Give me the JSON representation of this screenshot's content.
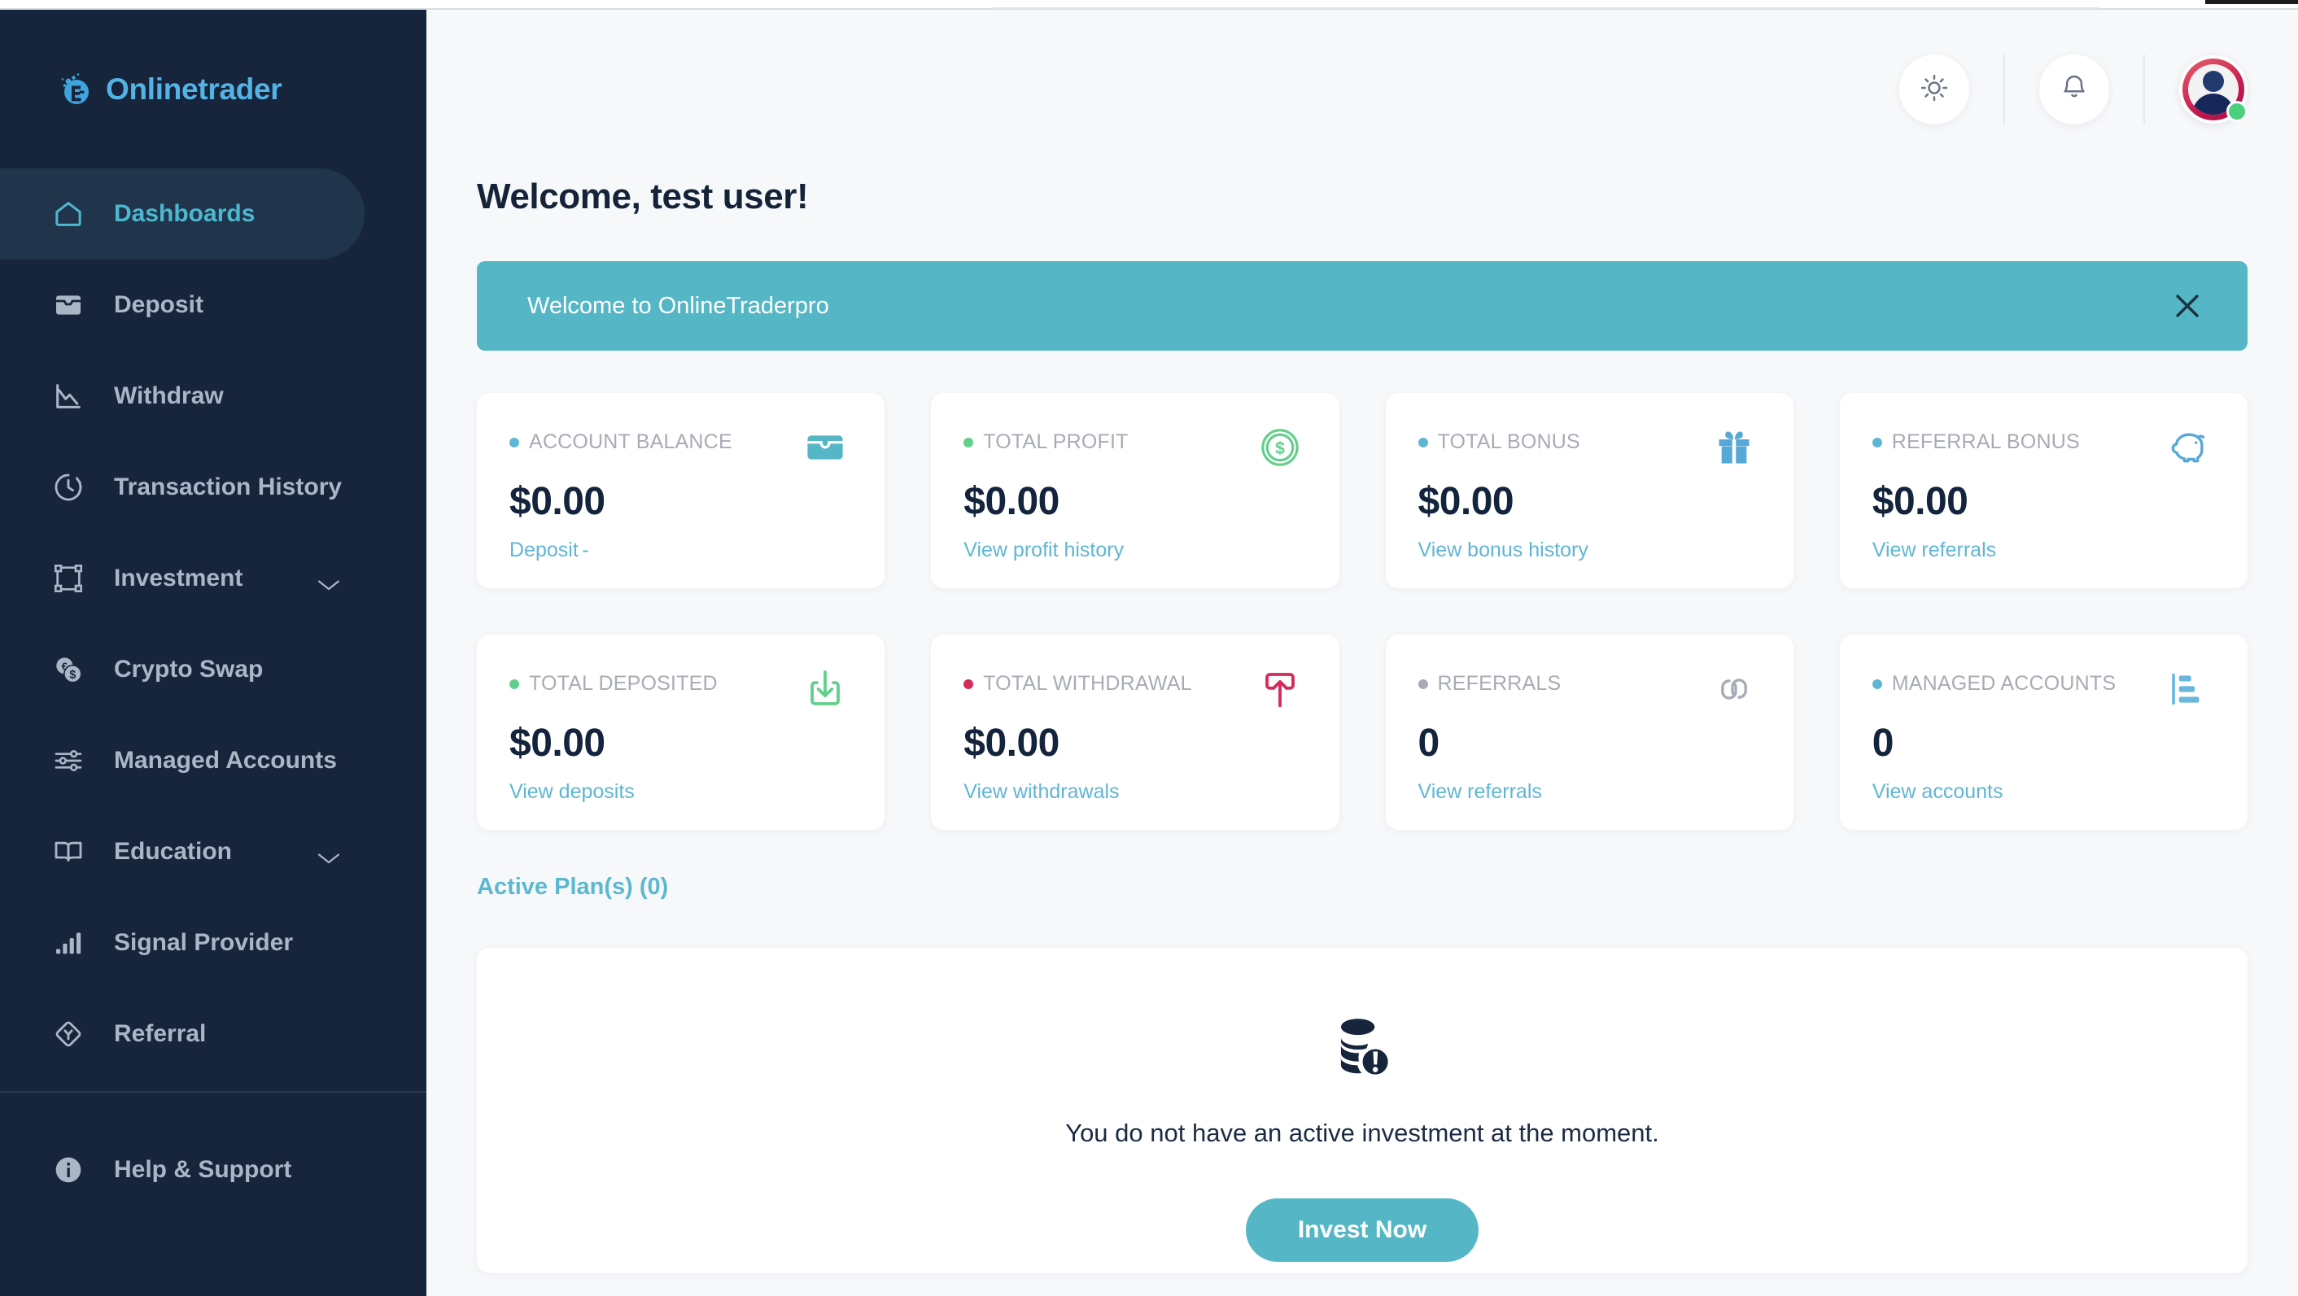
{
  "brand": {
    "name": "Onlinetrader",
    "logo_icon": "onlinetrader-logo-icon",
    "accent": "#52b3e4"
  },
  "sidebar": {
    "items": [
      {
        "label": "Dashboards",
        "icon": "home-icon",
        "active": true,
        "expandable": false
      },
      {
        "label": "Deposit",
        "icon": "inbox-icon",
        "active": false,
        "expandable": false
      },
      {
        "label": "Withdraw",
        "icon": "line-chart-down-icon",
        "active": false,
        "expandable": false
      },
      {
        "label": "Transaction History",
        "icon": "clock-history-icon",
        "active": false,
        "expandable": false
      },
      {
        "label": "Investment",
        "icon": "frame-select-icon",
        "active": false,
        "expandable": true
      },
      {
        "label": "Crypto Swap",
        "icon": "coins-swap-icon",
        "active": false,
        "expandable": false
      },
      {
        "label": "Managed Accounts",
        "icon": "sliders-icon",
        "active": false,
        "expandable": false
      },
      {
        "label": "Education",
        "icon": "book-open-icon",
        "active": false,
        "expandable": true
      },
      {
        "label": "Signal Provider",
        "icon": "bar-chart-icon",
        "active": false,
        "expandable": false
      },
      {
        "label": "Referral",
        "icon": "diamond-y-icon",
        "active": false,
        "expandable": false
      }
    ],
    "footer": {
      "label": "Help & Support",
      "icon": "info-circle-icon"
    }
  },
  "topbar": {
    "theme_toggle_icon": "sun-icon",
    "notifications_icon": "bell-icon",
    "avatar_icon": "user-avatar",
    "status": "online"
  },
  "header": {
    "title": "Welcome, test user!"
  },
  "banner": {
    "text": "Welcome to OnlineTraderpro",
    "close_icon": "close-icon",
    "bg": "#55b7c6"
  },
  "cards": [
    {
      "title": "ACCOUNT BALANCE",
      "value": "$0.00",
      "link": "Deposit",
      "link_suffix": "-",
      "icon": "wallet-icon",
      "bullet": "#5fb6d4",
      "icon_color": "#55b7c6"
    },
    {
      "title": "TOTAL PROFIT",
      "value": "$0.00",
      "link": "View profit history",
      "link_suffix": "",
      "icon": "dollar-coin-icon",
      "bullet": "#63cf8c",
      "icon_color": "#63cf8c"
    },
    {
      "title": "TOTAL BONUS",
      "value": "$0.00",
      "link": "View bonus history",
      "link_suffix": "",
      "icon": "gift-icon",
      "bullet": "#5fb6d4",
      "icon_color": "#56a8d6"
    },
    {
      "title": "REFERRAL BONUS",
      "value": "$0.00",
      "link": "View referrals",
      "link_suffix": "",
      "icon": "piggy-bank-icon",
      "bullet": "#5fb6d4",
      "icon_color": "#56a8d6"
    },
    {
      "title": "TOTAL DEPOSITED",
      "value": "$0.00",
      "link": "View deposits",
      "link_suffix": "",
      "icon": "download-icon",
      "bullet": "#63cf8c",
      "icon_color": "#63cf8c"
    },
    {
      "title": "TOTAL WITHDRAWAL",
      "value": "$0.00",
      "link": "View withdrawals",
      "link_suffix": "",
      "icon": "upload-icon",
      "bullet": "#d62a5a",
      "icon_color": "#d62a5a"
    },
    {
      "title": "REFERRALS",
      "value": "0",
      "link": "View referrals",
      "link_suffix": "",
      "icon": "link-chain-icon",
      "bullet": "#a7acb4",
      "icon_color": "#a7acb4"
    },
    {
      "title": "MANAGED ACCOUNTS",
      "value": "0",
      "link": "View accounts",
      "link_suffix": "",
      "icon": "bar-list-icon",
      "bullet": "#5fb6d4",
      "icon_color": "#6bb6dd"
    }
  ],
  "active_plans": {
    "title": "Active Plan(s) (0)"
  },
  "empty_state": {
    "icon": "coins-alert-icon",
    "message": "You do not have an active investment at the moment.",
    "button_label": "Invest Now"
  }
}
